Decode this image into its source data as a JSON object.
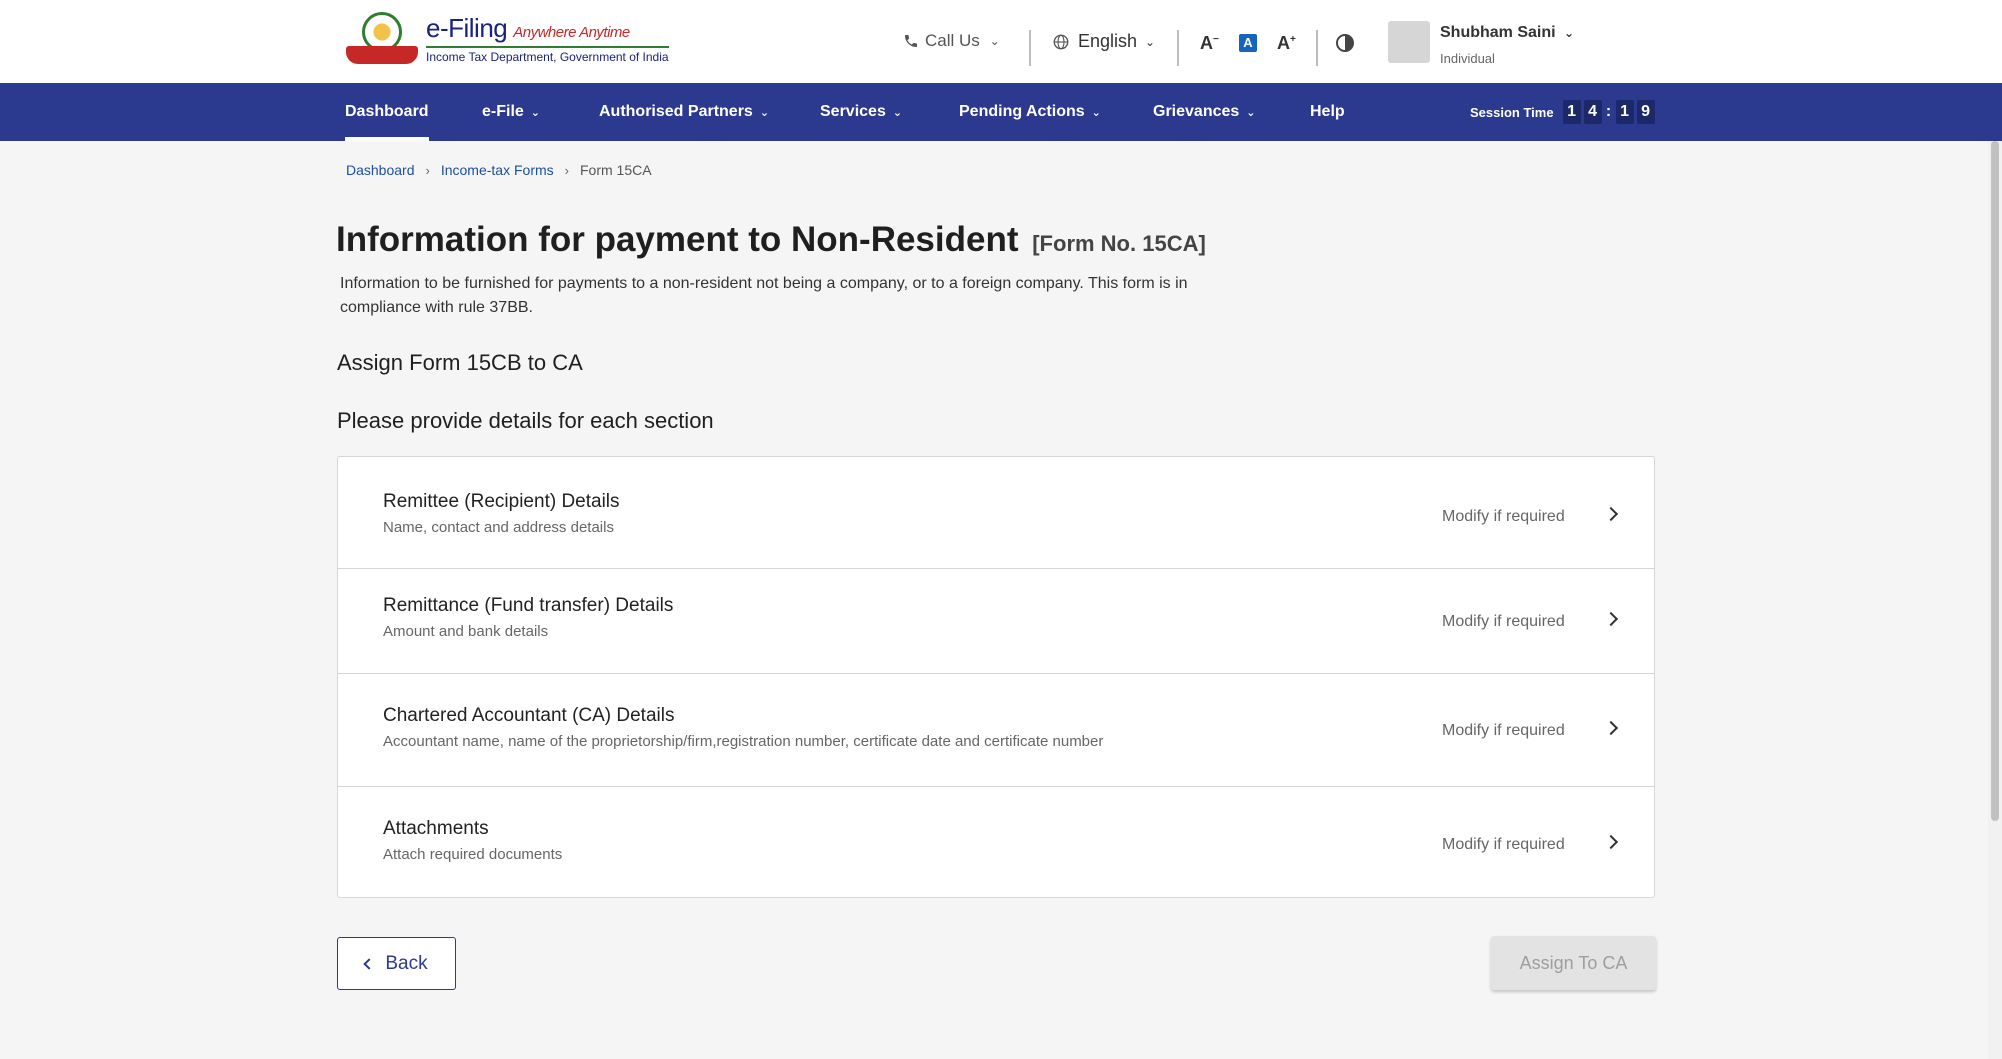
{
  "header": {
    "logo": {
      "title": "e-Filing",
      "tagline": "Anywhere Anytime",
      "subtitle": "Income Tax Department, Government of India"
    },
    "call_us": "Call Us",
    "language": "English",
    "font_decrease": "A",
    "font_normal": "A",
    "font_increase": "A",
    "user": {
      "name": "Shubham Saini",
      "role": "Individual"
    }
  },
  "nav": {
    "items": [
      {
        "label": "Dashboard",
        "active": true
      },
      {
        "label": "e-File",
        "dropdown": true
      },
      {
        "label": "Authorised Partners",
        "dropdown": true
      },
      {
        "label": "Services",
        "dropdown": true
      },
      {
        "label": "Pending Actions",
        "dropdown": true
      },
      {
        "label": "Grievances",
        "dropdown": true
      },
      {
        "label": "Help"
      }
    ],
    "session_label": "Session Time",
    "session_digits": [
      "1",
      "4",
      ":",
      "1",
      "9"
    ]
  },
  "breadcrumb": {
    "items": [
      {
        "label": "Dashboard",
        "link": true
      },
      {
        "label": "Income-tax Forms",
        "link": true
      },
      {
        "label": "Form 15CA",
        "link": false
      }
    ]
  },
  "page": {
    "title": "Information for payment to Non-Resident",
    "form_no": "[Form No. 15CA]",
    "description": "Information to be furnished for payments to a non-resident not being a company, or to a foreign company. This form is in compliance with rule 37BB.",
    "assign_heading": "Assign Form 15CB to CA",
    "provide_heading": "Please provide details for each section"
  },
  "sections": [
    {
      "title": "Remittee (Recipient) Details",
      "subtitle": "Name, contact and address details",
      "action": "Modify if required"
    },
    {
      "title": "Remittance (Fund transfer) Details",
      "subtitle": "Amount and bank details",
      "action": "Modify if required"
    },
    {
      "title": "Chartered Accountant (CA) Details",
      "subtitle": "Accountant name, name of the proprietorship/firm,registration number, certificate date and certificate number",
      "action": "Modify if required"
    },
    {
      "title": "Attachments",
      "subtitle": "Attach required documents",
      "action": "Modify if required"
    }
  ],
  "buttons": {
    "back": "Back",
    "assign": "Assign To CA"
  },
  "colors": {
    "nav_bg": "#2b3a8f",
    "link": "#1d4fa6",
    "disabled_btn": "#e3e3e3"
  }
}
